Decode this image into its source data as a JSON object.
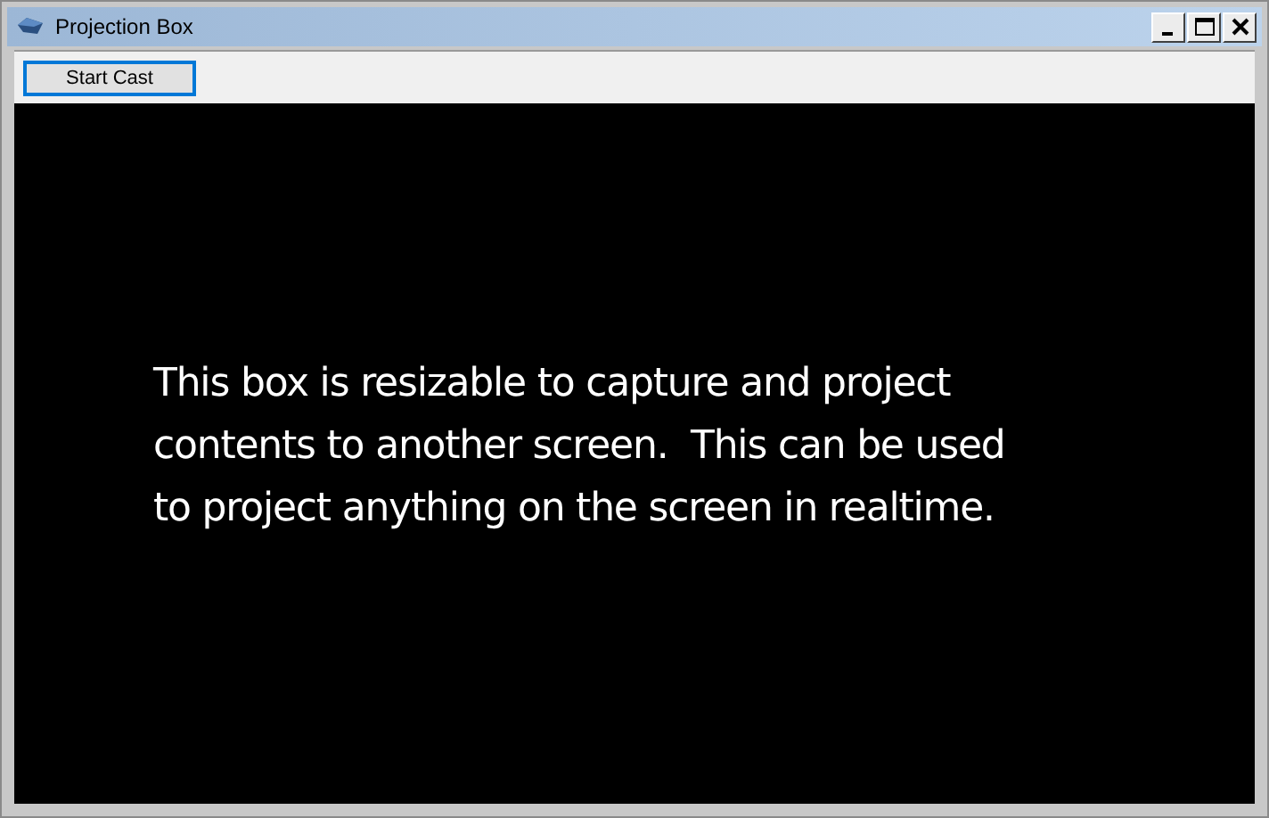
{
  "window": {
    "title": "Projection Box"
  },
  "toolbar": {
    "button": "Start Cast"
  },
  "projection": {
    "lines": [
      "This box is resizable to capture and project",
      "contents to another screen.  This can be used",
      "to project anything on the screen in realtime."
    ]
  }
}
